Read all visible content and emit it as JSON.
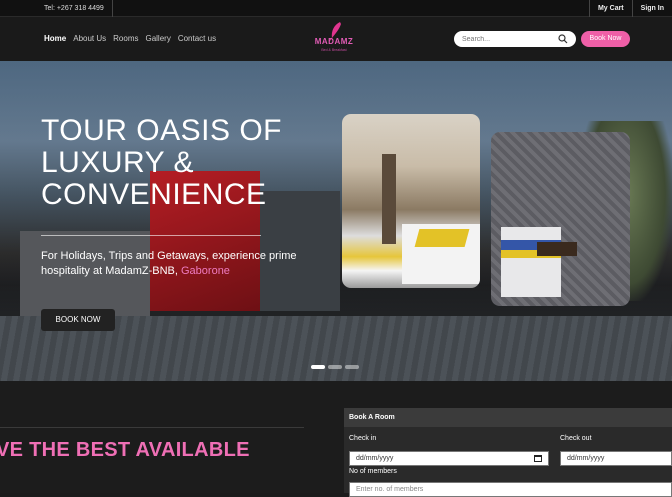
{
  "topbar": {
    "tel": "Tel: +267 318 4499",
    "my_cart": "My Cart",
    "sign_in": "Sign In"
  },
  "nav": {
    "items": [
      {
        "label": "Home"
      },
      {
        "label": "About Us"
      },
      {
        "label": "Rooms"
      },
      {
        "label": "Gallery"
      },
      {
        "label": "Contact us"
      }
    ],
    "logo_word": "MADAMZ",
    "logo_sub": "Bed & Breakfast",
    "search_placeholder": "Search...",
    "book_now": "Book Now"
  },
  "hero": {
    "title": "TOUR OASIS OF LUXURY & CONVENIENCE",
    "tagline_prefix": "For Holidays, Trips and Getaways, experience prime hospitality at MadamZ-BNB, ",
    "tagline_highlight": "Gaborone",
    "button": "BOOK NOW",
    "slides": 3,
    "active_slide": 1
  },
  "section": {
    "heading": "VE THE BEST AVAILABLE"
  },
  "booking": {
    "title": "Book A Room",
    "check_in_label": "Check in",
    "check_in_value": "dd/mm/yyyy",
    "check_out_label": "Check out",
    "check_out_value": "dd/mm/yyyy",
    "members_label": "No of members",
    "members_placeholder": "Enter no. of members"
  },
  "colors": {
    "accent": "#ef5fa7",
    "heading_pink": "#ef6fb5"
  }
}
